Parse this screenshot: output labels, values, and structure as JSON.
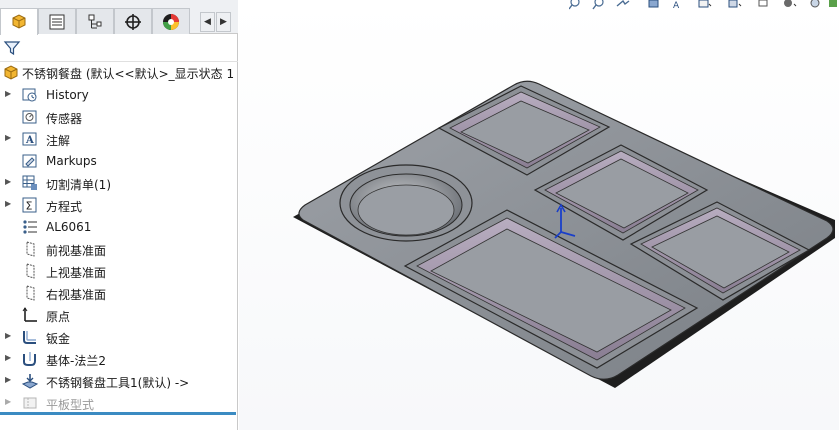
{
  "tree": {
    "root": {
      "label": "不锈钢餐盘 (默认<<默认>_显示状态 1"
    },
    "items": [
      {
        "label": "History",
        "icon": "history-icon",
        "expandable": true
      },
      {
        "label": "传感器",
        "icon": "sensor-icon",
        "expandable": false
      },
      {
        "label": "注解",
        "icon": "annotation-icon",
        "expandable": true
      },
      {
        "label": "Markups",
        "icon": "markups-icon",
        "expandable": false
      },
      {
        "label": "切割清单(1)",
        "icon": "cut-list-icon",
        "expandable": true
      },
      {
        "label": "方程式",
        "icon": "equation-icon",
        "expandable": true
      },
      {
        "label": "AL6061",
        "icon": "material-icon",
        "expandable": false
      },
      {
        "label": "前视基准面",
        "icon": "plane-icon",
        "expandable": false
      },
      {
        "label": "上视基准面",
        "icon": "plane-icon",
        "expandable": false
      },
      {
        "label": "右视基准面",
        "icon": "plane-icon",
        "expandable": false
      },
      {
        "label": "原点",
        "icon": "origin-icon",
        "expandable": false
      },
      {
        "label": "钣金",
        "icon": "sheet-metal-icon",
        "expandable": true
      },
      {
        "label": "基体-法兰2",
        "icon": "base-flange-icon",
        "expandable": true
      },
      {
        "label": "不锈钢餐盘工具1(默认) ->",
        "icon": "forming-tool-icon",
        "expandable": true
      },
      {
        "label": "平板型式",
        "icon": "flat-pattern-icon",
        "expandable": true,
        "suppressed": true
      }
    ]
  },
  "tabs": [
    {
      "name": "tab-feature-manager",
      "icon": "feature-manager-icon"
    },
    {
      "name": "tab-property-manager",
      "icon": "property-manager-icon"
    },
    {
      "name": "tab-configuration-manager",
      "icon": "configuration-manager-icon"
    },
    {
      "name": "tab-dimxpert-manager",
      "icon": "dimxpert-icon"
    },
    {
      "name": "tab-display-manager",
      "icon": "display-manager-icon"
    }
  ],
  "colors": {
    "accent": "#3b8bc2",
    "model_fill": "#8c9096",
    "model_edge": "#2a2a2a",
    "pocket_wall": "#9a8ca3"
  }
}
